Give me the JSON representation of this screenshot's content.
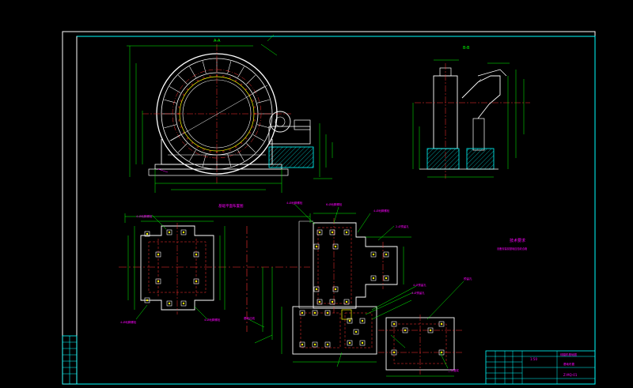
{
  "colors": {
    "background": "#000000",
    "frame": "#ffffff",
    "border": "#00ffff",
    "outline": "#ffffff",
    "dimension": "#00ff00",
    "centerline": "#ff3333",
    "hidden": "#ff3333",
    "detail": "#ffff00",
    "annotation": "#ff00ff",
    "steel": "#00ffff",
    "concrete": "#00ffff",
    "title_text": "#ff00ff"
  },
  "views": {
    "section_a": "A-A",
    "section_b": "B-B",
    "plan_title": "基础平面布置图"
  },
  "notes": {
    "title": "技术要求",
    "body": "设备安装前基础应验收合格"
  },
  "callouts": [
    "4-Ø地脚螺栓",
    "4-Ø地脚螺栓",
    "4-Ø地脚螺栓",
    "4-Ø地脚螺栓",
    "6-Ø地脚螺栓",
    "4-Ø地脚螺栓",
    "2-Ø预留孔",
    "4-Ø预留孔",
    "4-Ø预留孔",
    "预留孔",
    "二次灌浆",
    "基础边线"
  ],
  "title_block": {
    "scale": "1:50",
    "drawing_name": "球磨机基础图",
    "sub_name": "基础布置",
    "drawing_no": "Z-MQ-01"
  }
}
